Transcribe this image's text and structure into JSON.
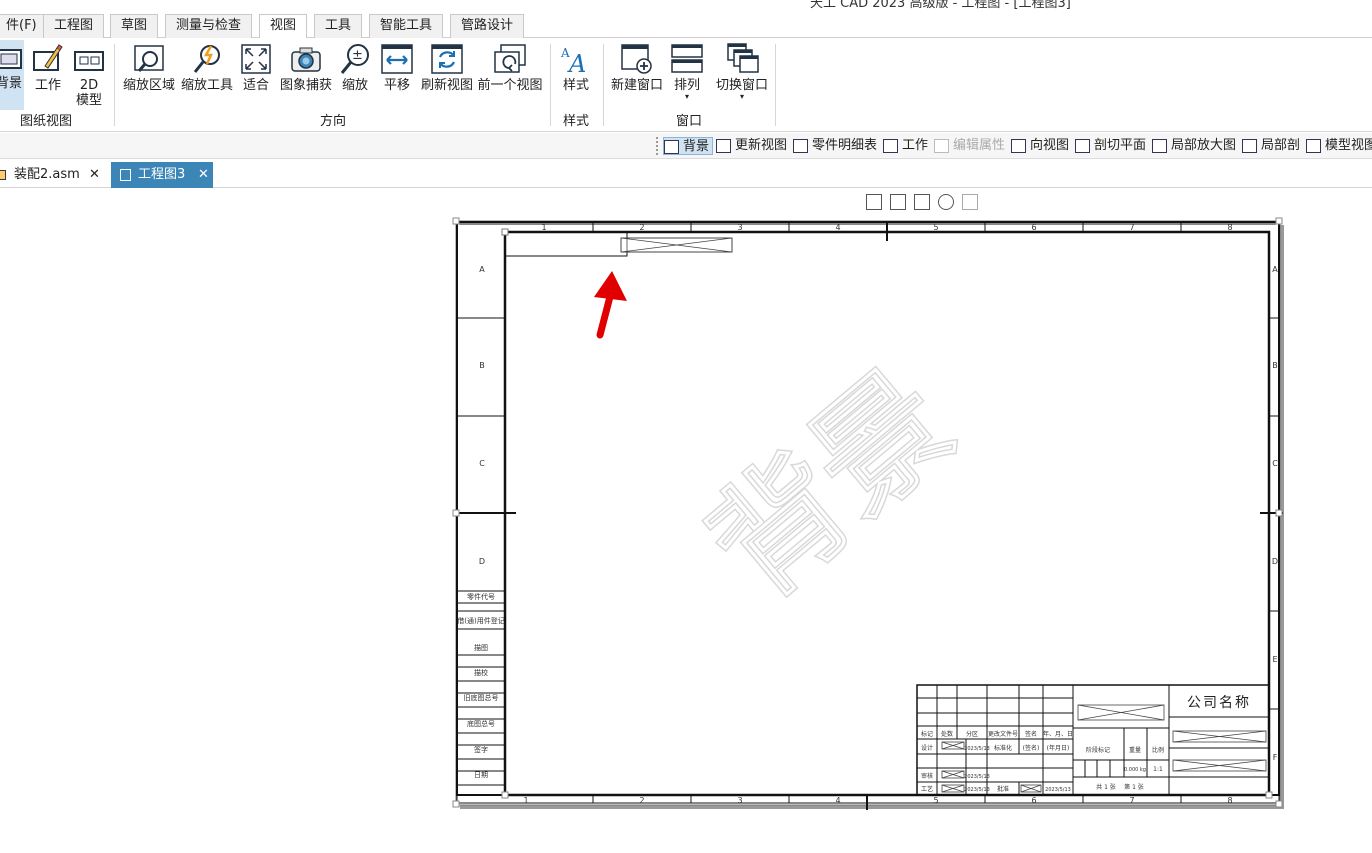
{
  "window": {
    "title": "天工 CAD 2023 高级版 - 工程图 - [工程图3]"
  },
  "menu_tabs": [
    {
      "label": "件(F)"
    },
    {
      "label": "工程图"
    },
    {
      "label": "草图"
    },
    {
      "label": "测量与检查"
    },
    {
      "label": "视图",
      "active": true
    },
    {
      "label": "工具"
    },
    {
      "label": "智能工具"
    },
    {
      "label": "管路设计"
    }
  ],
  "ribbon": {
    "buttons": [
      {
        "label": "背景",
        "icon": "sheet-background-icon"
      },
      {
        "label": "工作",
        "icon": "sheet-work-icon"
      },
      {
        "label": "2D",
        "label2": "模型",
        "icon": "2d-model-icon"
      },
      {
        "label": "缩放区域",
        "icon": "zoom-area-icon"
      },
      {
        "label": "缩放工具",
        "icon": "zoom-tool-icon"
      },
      {
        "label": "适合",
        "icon": "fit-icon"
      },
      {
        "label": "图象捕获",
        "icon": "camera-icon"
      },
      {
        "label": "缩放",
        "icon": "zoom-icon"
      },
      {
        "label": "平移",
        "icon": "pan-icon"
      },
      {
        "label": "刷新视图",
        "icon": "refresh-view-icon"
      },
      {
        "label": "前一个视图",
        "icon": "previous-view-icon"
      },
      {
        "label": "样式",
        "icon": "style-icon"
      },
      {
        "label": "新建窗口",
        "icon": "new-window-icon"
      },
      {
        "label": "排列",
        "icon": "arrange-icon"
      },
      {
        "label": "切换窗口",
        "icon": "switch-window-icon"
      }
    ],
    "groups": [
      "图纸视图",
      "方向",
      "样式",
      "窗口"
    ]
  },
  "toolbar2": [
    {
      "label": "背景",
      "icon": "sheet-background-icon"
    },
    {
      "label": "更新视图",
      "icon": "update-view-icon"
    },
    {
      "label": "零件明细表",
      "icon": "parts-list-icon"
    },
    {
      "label": "工作",
      "icon": "work-icon"
    },
    {
      "label": "编辑属性",
      "icon": "edit-properties-icon"
    },
    {
      "label": "向视图",
      "icon": "auxiliary-view-icon"
    },
    {
      "label": "剖切平面",
      "icon": "cutting-plane-icon"
    },
    {
      "label": "局部放大图",
      "icon": "detail-view-icon"
    },
    {
      "label": "局部剖",
      "icon": "broken-out-section-icon"
    },
    {
      "label": "模型视图",
      "icon": "model-view-icon"
    }
  ],
  "doc_tabs": [
    {
      "label": "装配2.asm",
      "close": "✕"
    },
    {
      "label": "工程图3",
      "close": "✕",
      "active": true
    }
  ],
  "drawing": {
    "watermark": "背景",
    "col_labels": [
      "1",
      "2",
      "3",
      "4",
      "5",
      "6",
      "7",
      "8"
    ],
    "row_labels": [
      "A",
      "B",
      "C",
      "D"
    ],
    "right_row_labels": [
      "A",
      "B",
      "C",
      "D",
      "E",
      "F"
    ],
    "left_strip": [
      "零件代号",
      "借(通)用件登记",
      "描图",
      "描校",
      "旧底图总号",
      "底图总号",
      "签字",
      "日期"
    ],
    "title_block": {
      "company": "公司名称",
      "rev_headers": [
        "标记",
        "处数",
        "分区",
        "更改文件号",
        "签名",
        "年、月、日"
      ],
      "design_label": "设计",
      "std_label": "标准化",
      "sig_label": "(签名)",
      "date_label": "(年月日)",
      "review_label": "审核",
      "process_label": "工艺",
      "approve_label": "批准",
      "date": "2023/5/13",
      "stage_label": "阶段标记",
      "weight_label": "重量",
      "scale_label": "比例",
      "weight": "0.000 kg",
      "scale": "1:1",
      "sheets": "共 1 张",
      "sheet_no": "第 1 张"
    }
  },
  "colors": {
    "accent_tab": "#3c85b7",
    "arrow": "#e00000"
  }
}
